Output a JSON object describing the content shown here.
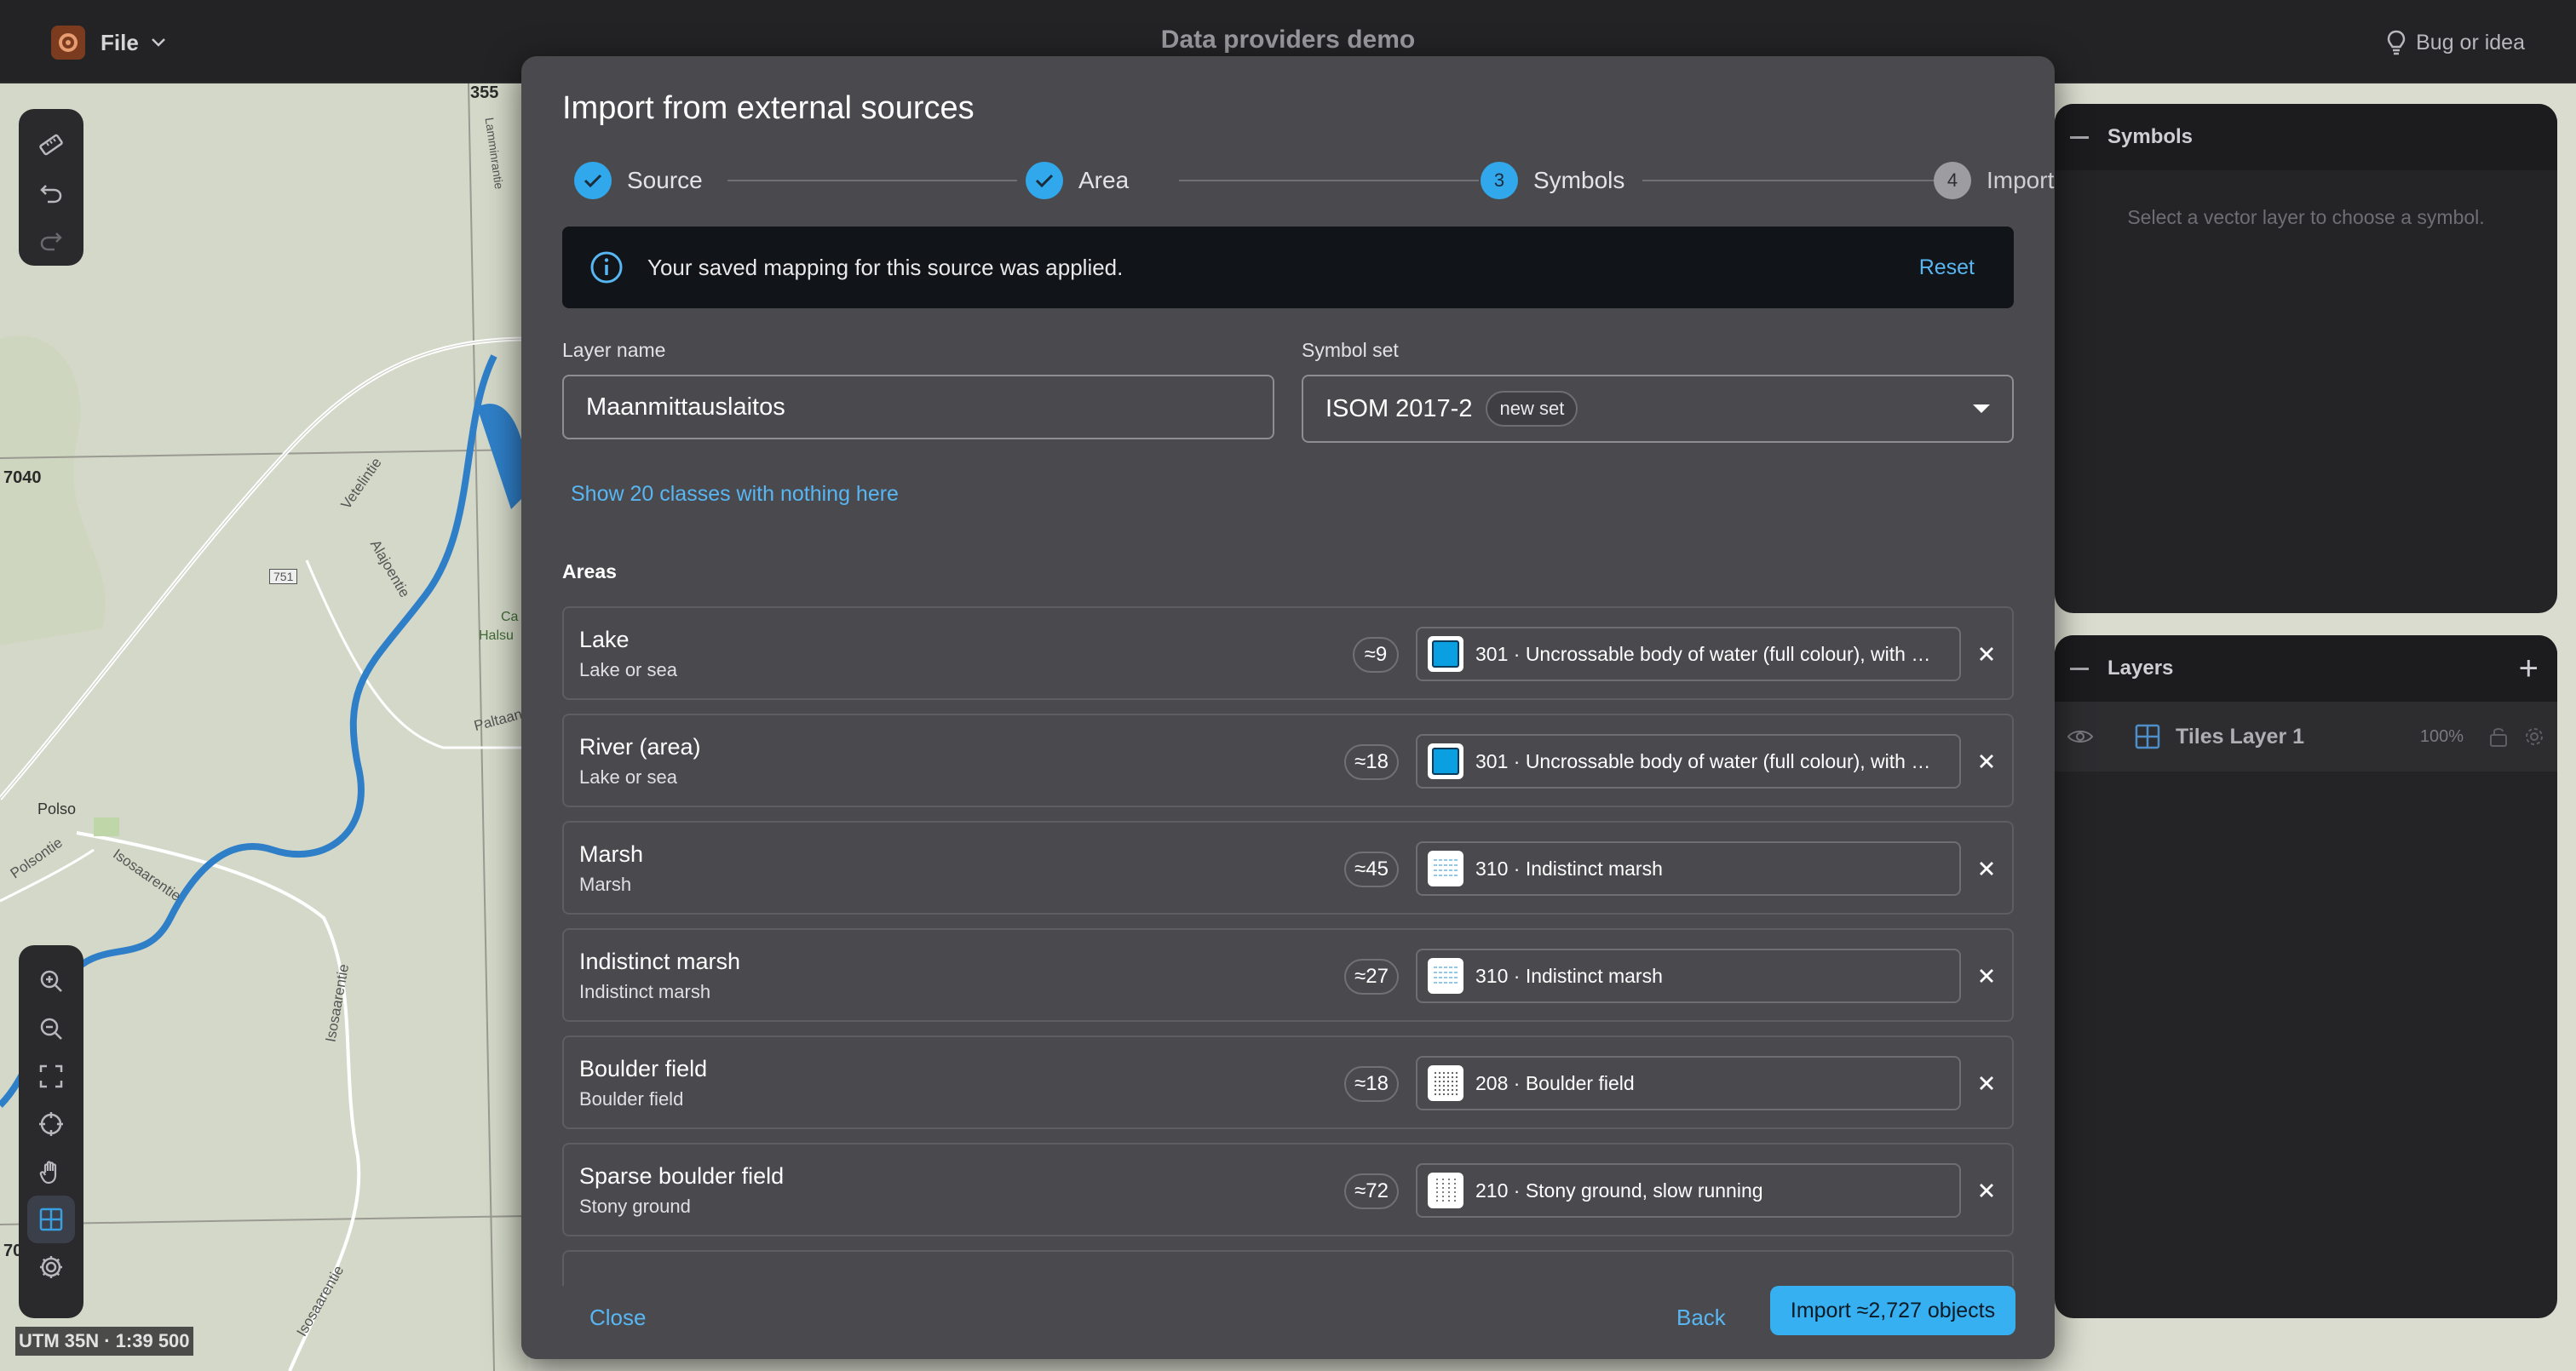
{
  "topbar": {
    "file_label": "File",
    "title": "Data providers demo",
    "bug_label": "Bug or idea"
  },
  "map": {
    "labels": {
      "grid_355": "355",
      "grid_7040": "7040",
      "grid_70": "70",
      "road_751": "751",
      "polso": "Polso",
      "halsu": "Halsu",
      "ca": "Ca"
    },
    "road_names": {
      "vetelintie": "Vetelintie",
      "alajoentie": "Alajoentie",
      "paltaanranta": "Paltaan",
      "isosaarentie_1": "Isosaarentie",
      "isosaarentie_2": "Isosaarentie",
      "isosaarentie_3": "Isosaarentie",
      "polsontie": "Polsontie",
      "lammintie": "Lamminrantie"
    },
    "coords_label": "UTM 35N · 1:39 500"
  },
  "toolbar_top": [
    "ruler-icon",
    "undo-icon",
    "redo-icon"
  ],
  "toolbar_bottom": [
    "zoom-in-icon",
    "zoom-out-icon",
    "fit-extent-icon",
    "locate-icon",
    "pan-hand-icon",
    "grid-icon",
    "settings-icon"
  ],
  "symbols_panel": {
    "title": "Symbols",
    "hint": "Select a vector layer to choose a symbol."
  },
  "layers_panel": {
    "title": "Layers",
    "add_label": "+",
    "layer": {
      "name": "Tiles Layer 1",
      "opacity": "100%"
    }
  },
  "modal": {
    "title": "Import from external sources",
    "steps": [
      {
        "number": "1",
        "label": "Source",
        "state": "done"
      },
      {
        "number": "2",
        "label": "Area",
        "state": "done"
      },
      {
        "number": "3",
        "label": "Symbols",
        "state": "current"
      },
      {
        "number": "4",
        "label": "Import",
        "state": "todo"
      }
    ],
    "banner": {
      "message": "Your saved mapping for this source was applied.",
      "reset_label": "Reset"
    },
    "layer_name": {
      "label": "Layer name",
      "value": "Maanmittauslaitos"
    },
    "symbol_set": {
      "label": "Symbol set",
      "value": "ISOM 2017-2",
      "badge": "new set"
    },
    "show_classes_label": "Show 20 classes with nothing here",
    "section_title": "Areas",
    "rows": [
      {
        "name": "Lake",
        "sub": "Lake or sea",
        "count": "≈9",
        "symbol": "301 · Uncrossable body of water (full colour), with …",
        "swatch": "water"
      },
      {
        "name": "River (area)",
        "sub": "Lake or sea",
        "count": "≈18",
        "symbol": "301 · Uncrossable body of water (full colour), with …",
        "swatch": "water"
      },
      {
        "name": "Marsh",
        "sub": "Marsh",
        "count": "≈45",
        "symbol": "310 · Indistinct marsh",
        "swatch": "marsh"
      },
      {
        "name": "Indistinct marsh",
        "sub": "Indistinct marsh",
        "count": "≈27",
        "symbol": "310 · Indistinct marsh",
        "swatch": "marsh"
      },
      {
        "name": "Boulder field",
        "sub": "Boulder field",
        "count": "≈18",
        "symbol": "208 · Boulder field",
        "swatch": "boulder"
      },
      {
        "name": "Sparse boulder field",
        "sub": "Stony ground",
        "count": "≈72",
        "symbol": "210 · Stony ground, slow running",
        "swatch": "stony"
      }
    ],
    "footer": {
      "close_label": "Close",
      "back_label": "Back",
      "import_label": "Import ≈2,727 objects"
    }
  },
  "colors": {
    "accent": "#36b0f0",
    "link": "#58b6f2",
    "water": "#0a9fe0",
    "modal_bg": "#4a4a4e",
    "banner_bg": "#111418"
  }
}
